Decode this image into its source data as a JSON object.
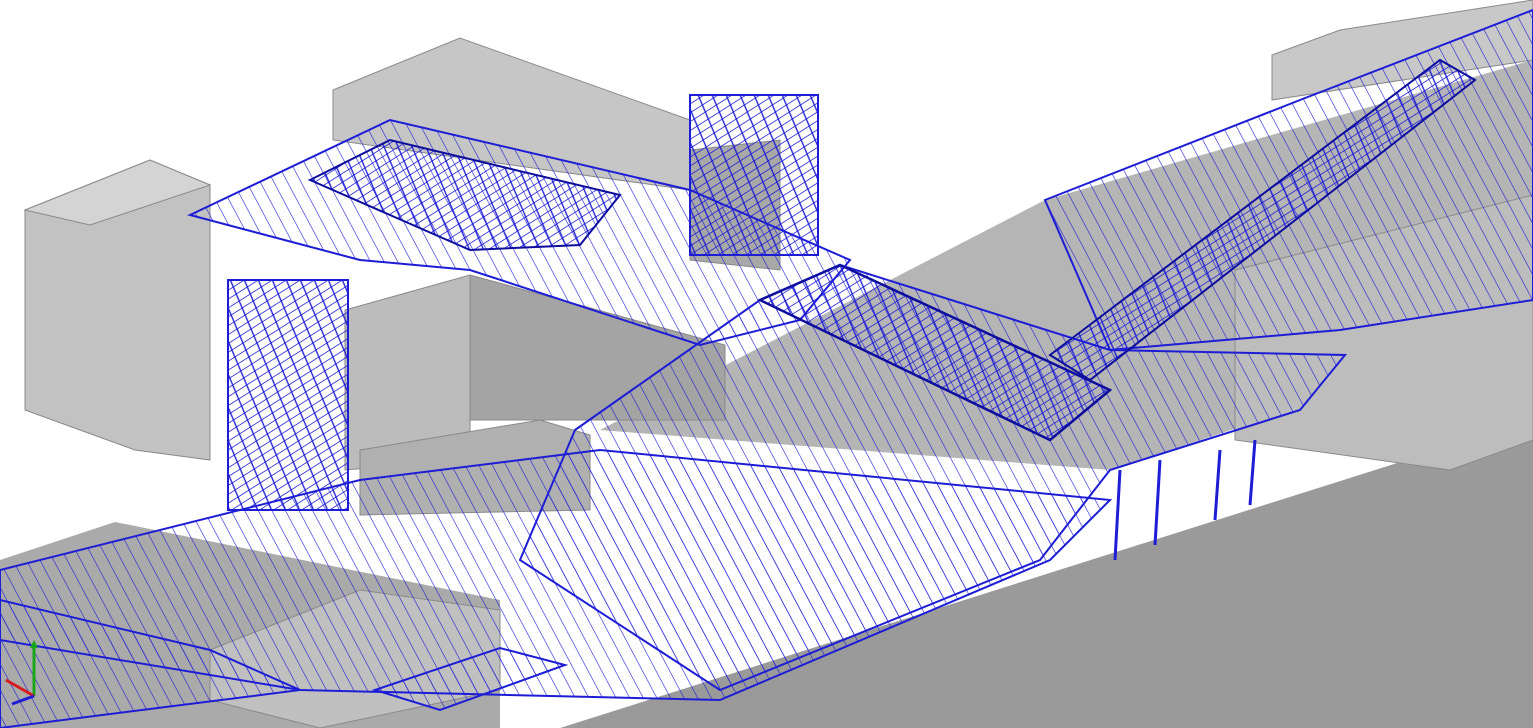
{
  "viewport": {
    "kind": "3D model view",
    "background_color": "#ffffff"
  },
  "colors": {
    "building_face_light": "#c4c4c4",
    "building_face_mid": "#a9a9a9",
    "building_face_dark": "#8f8f8f",
    "ground_slab": "#b8b8b8",
    "steel_members": "#1d1dd6",
    "steel_members_dark": "#0d0d9e"
  },
  "icons": {
    "ucs": "ucs-axis-icon"
  }
}
